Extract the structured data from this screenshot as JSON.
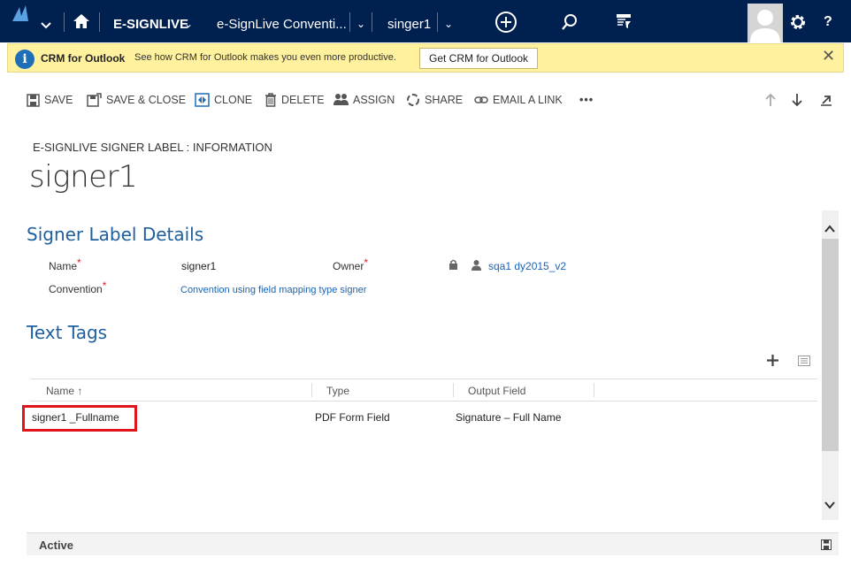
{
  "nav": {
    "app_name": "E-SIGNLIVE",
    "breadcrumb_entity": "e-SignLive Conventi...",
    "breadcrumb_record": "singer1"
  },
  "notification": {
    "title": "CRM for Outlook",
    "message": "See how CRM for Outlook makes you even more productive.",
    "button": "Get CRM for Outlook",
    "close": "✕"
  },
  "commands": [
    {
      "label": "SAVE"
    },
    {
      "label": "SAVE & CLOSE"
    },
    {
      "label": "CLONE"
    },
    {
      "label": "DELETE"
    },
    {
      "label": "ASSIGN"
    },
    {
      "label": "SHARE"
    },
    {
      "label": "EMAIL A LINK"
    }
  ],
  "more": "•••",
  "form": {
    "breadcrumb": "E-SIGNLIVE SIGNER LABEL : INFORMATION",
    "title": "signer1",
    "section1": "Signer Label Details",
    "name_label": "Name",
    "name_value": "signer1",
    "owner_label": "Owner",
    "owner_value": "sqa1 dy2015_v2",
    "convention_label": "Convention",
    "convention_value": "Convention using field mapping type signer",
    "required_mark": "*",
    "section2": "Text Tags"
  },
  "grid": {
    "columns": [
      "Name ↑",
      "Type",
      "Output Field"
    ],
    "rows": [
      {
        "name": "signer1 _Fullname",
        "type": "PDF Form Field",
        "output": "Signature – Full Name"
      }
    ]
  },
  "footer": {
    "status": "Active"
  },
  "colors": {
    "navbar": "#002050",
    "notification": "#fff19d",
    "section": "#1e5f9f",
    "link": "#1a63b3",
    "highlight": "#e0141b"
  }
}
